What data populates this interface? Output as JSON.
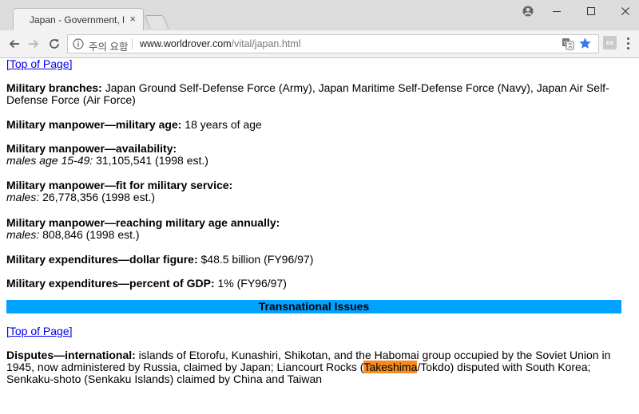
{
  "browser": {
    "tab_title": "Japan - Government, His",
    "tab_close": "×",
    "security_label": "주의 요함",
    "url_host": "www.worldrover.com",
    "url_path": "/vital/japan.html",
    "extension_label": "ex"
  },
  "page": {
    "top_link_1": "[Top of Page]",
    "top_link_2": "[Top of Page]",
    "sections": {
      "branches": {
        "label": "Military branches:",
        "value": " Japan Ground Self-Defense Force (Army), Japan Maritime Self-Defense Force (Navy), Japan Air Self-Defense Force (Air Force)"
      },
      "age": {
        "label": "Military manpower—military age:",
        "value": " 18 years of age"
      },
      "availability": {
        "label": "Military manpower—availability:",
        "sub_label": "males age 15-49:",
        "value": " 31,105,541 (1998 est.)"
      },
      "fit": {
        "label": "Military manpower—fit for military service:",
        "sub_label": "males:",
        "value": " 26,778,356 (1998 est.)"
      },
      "reaching": {
        "label": "Military manpower—reaching military age annually:",
        "sub_label": "males:",
        "value": " 808,846 (1998 est.)"
      },
      "expenditure_dollar": {
        "label": "Military expenditures—dollar figure:",
        "value": " $48.5 billion (FY96/97)"
      },
      "expenditure_gdp": {
        "label": "Military expenditures—percent of GDP:",
        "value": " 1% (FY96/97)"
      }
    },
    "section_header": "Transnational Issues",
    "disputes": {
      "label": "Disputes—international:",
      "text_before": " islands of Etorofu, Kunashiri, Shikotan, and the Habomai group occupied by the Soviet Union in 1945, now administered by Russia, claimed by Japan; Liancourt Rocks (",
      "highlight": "Takeshima",
      "text_after": "/Tokdo) disputed with South Korea; Senkaku-shoto (Senkaku Islands) claimed by China and Taiwan"
    }
  },
  "colors": {
    "section_bar": "#00a2ff",
    "highlight": "#f68c1e",
    "link": "#0000ee",
    "bookmark_star": "#3b78e7"
  },
  "icons": {
    "back": "back-arrow-icon",
    "forward": "forward-arrow-icon",
    "reload": "reload-icon",
    "info": "info-icon",
    "translate": "translate-icon",
    "star": "bookmark-star-icon",
    "account": "account-icon",
    "minimize": "minimize-icon",
    "maximize": "maximize-icon",
    "close": "close-icon",
    "menu": "menu-dots-icon"
  }
}
